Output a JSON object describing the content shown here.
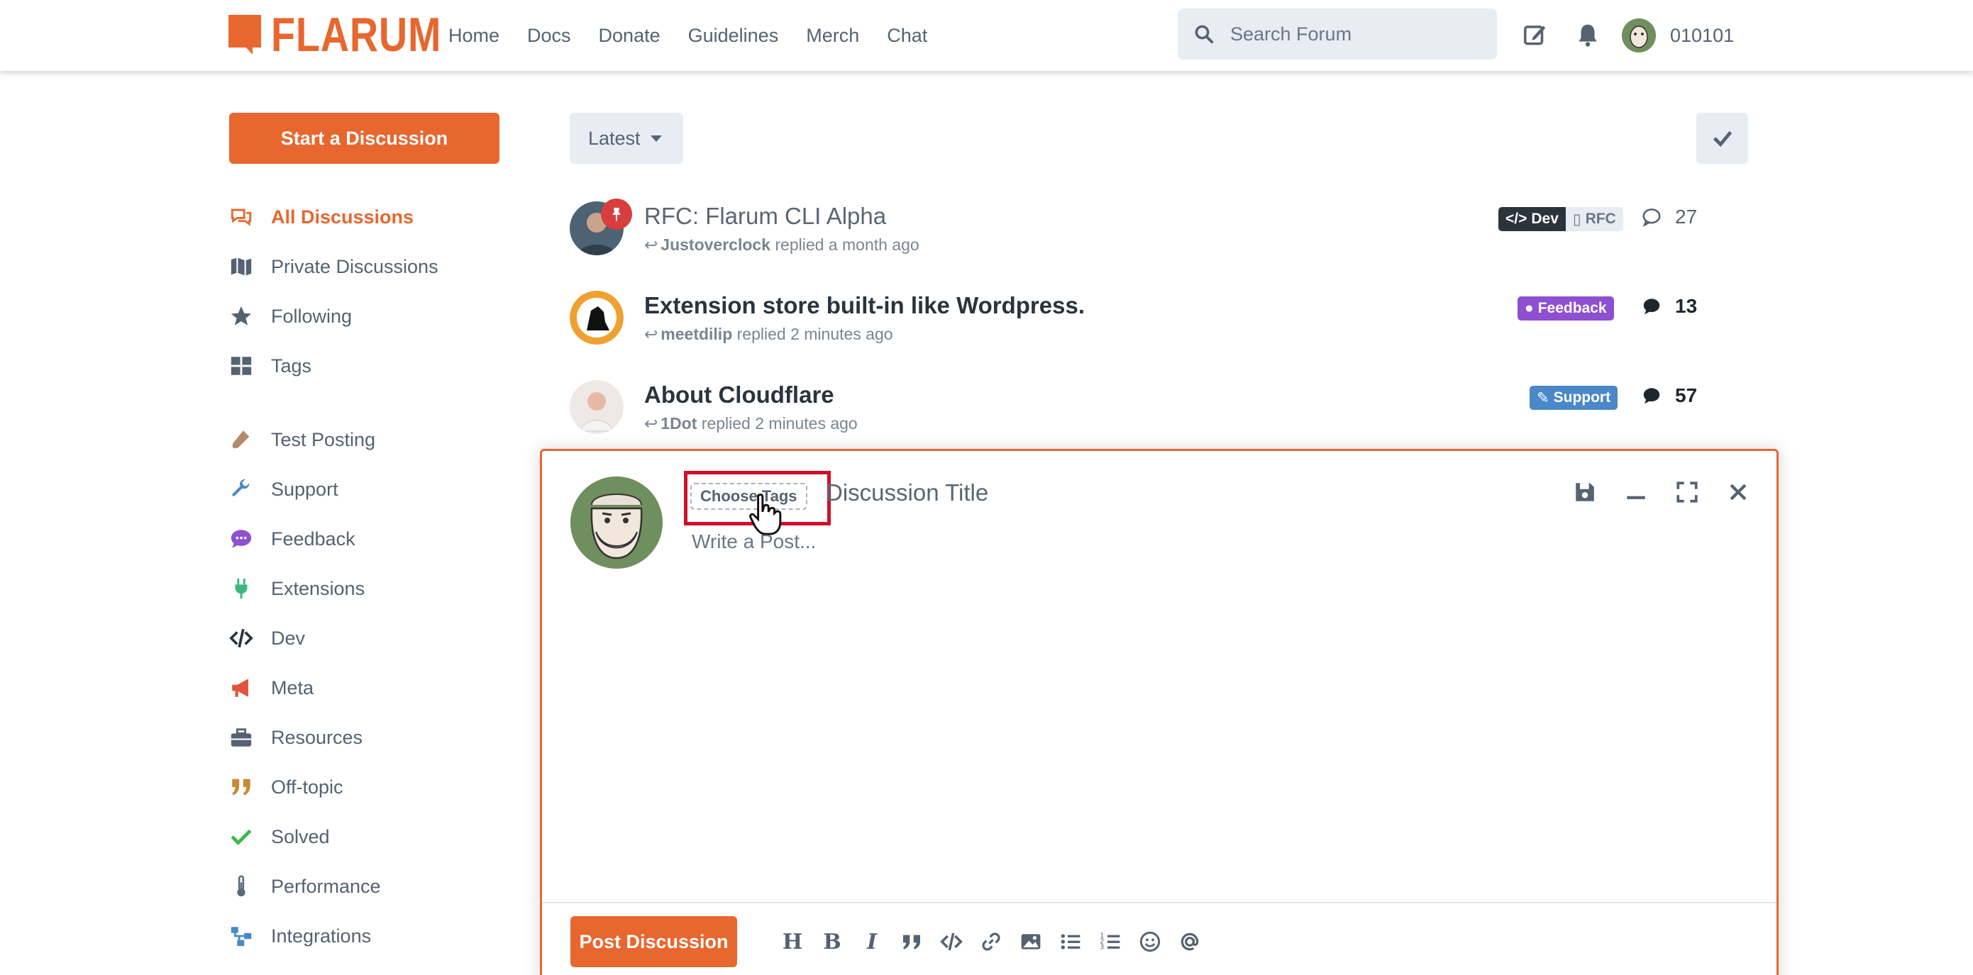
{
  "header": {
    "logo_text": "FLARUM",
    "nav": [
      "Home",
      "Docs",
      "Donate",
      "Guidelines",
      "Merch",
      "Chat"
    ],
    "search_placeholder": "Search Forum",
    "username": "010101"
  },
  "sidebar": {
    "start_button": "Start a Discussion",
    "primary": [
      {
        "label": "All Discussions",
        "icon": "comments-icon",
        "active": true
      },
      {
        "label": "Private Discussions",
        "icon": "map-icon"
      },
      {
        "label": "Following",
        "icon": "star-icon"
      },
      {
        "label": "Tags",
        "icon": "grid-icon"
      }
    ],
    "tags": [
      {
        "label": "Test Posting",
        "icon": "flask-icon",
        "color": "#b5896b"
      },
      {
        "label": "Support",
        "icon": "wrench-icon",
        "color": "#4a88c7"
      },
      {
        "label": "Feedback",
        "icon": "comment-icon",
        "color": "#8e4fd0"
      },
      {
        "label": "Extensions",
        "icon": "plug-icon",
        "color": "#3cb87c"
      },
      {
        "label": "Dev",
        "icon": "code-icon",
        "color": "#2b333c"
      },
      {
        "label": "Meta",
        "icon": "megaphone-icon",
        "color": "#e0553b"
      },
      {
        "label": "Resources",
        "icon": "toolbox-icon",
        "color": "#556272"
      },
      {
        "label": "Off-topic",
        "icon": "quote-icon",
        "color": "#c98a3a"
      },
      {
        "label": "Solved",
        "icon": "check-icon",
        "color": "#3cb84a"
      },
      {
        "label": "Performance",
        "icon": "thermometer-icon",
        "color": "#5a6a7a"
      },
      {
        "label": "Integrations",
        "icon": "network-icon",
        "color": "#4a88c7"
      }
    ]
  },
  "toolbar": {
    "sort_label": "Latest"
  },
  "discussions": [
    {
      "title": "RFC: Flarum CLI Alpha",
      "user": "Justoverclock",
      "action": "replied a month ago",
      "count": "27",
      "read": true,
      "pinned": true,
      "tags": [
        {
          "label": "Dev",
          "color": "#2b333c"
        },
        {
          "label": "RFC",
          "color": "#e8ecf3"
        }
      ]
    },
    {
      "title": "Extension store built-in like Wordpress.",
      "user": "meetdilip",
      "action": "replied 2 minutes ago",
      "count": "13",
      "read": false,
      "tags": [
        {
          "label": "Feedback",
          "color": "#8e4fd0"
        }
      ]
    },
    {
      "title": "About Cloudflare",
      "user": "1Dot",
      "action": "replied 2 minutes ago",
      "count": "57",
      "read": false,
      "tags": [
        {
          "label": "Support",
          "color": "#4a88c7"
        }
      ]
    }
  ],
  "composer": {
    "choose_tags": "Choose Tags",
    "title_placeholder": "Discussion Title",
    "post_placeholder": "Write a Post...",
    "post_button": "Post Discussion",
    "format_tools": [
      "header-icon",
      "bold-icon",
      "italic-icon",
      "quote-icon",
      "code-icon",
      "link-icon",
      "image-icon",
      "bullet-list-icon",
      "numbered-list-icon",
      "emoji-icon",
      "mention-icon"
    ]
  },
  "colors": {
    "accent": "#e7672e",
    "highlight": "#d0102a"
  }
}
